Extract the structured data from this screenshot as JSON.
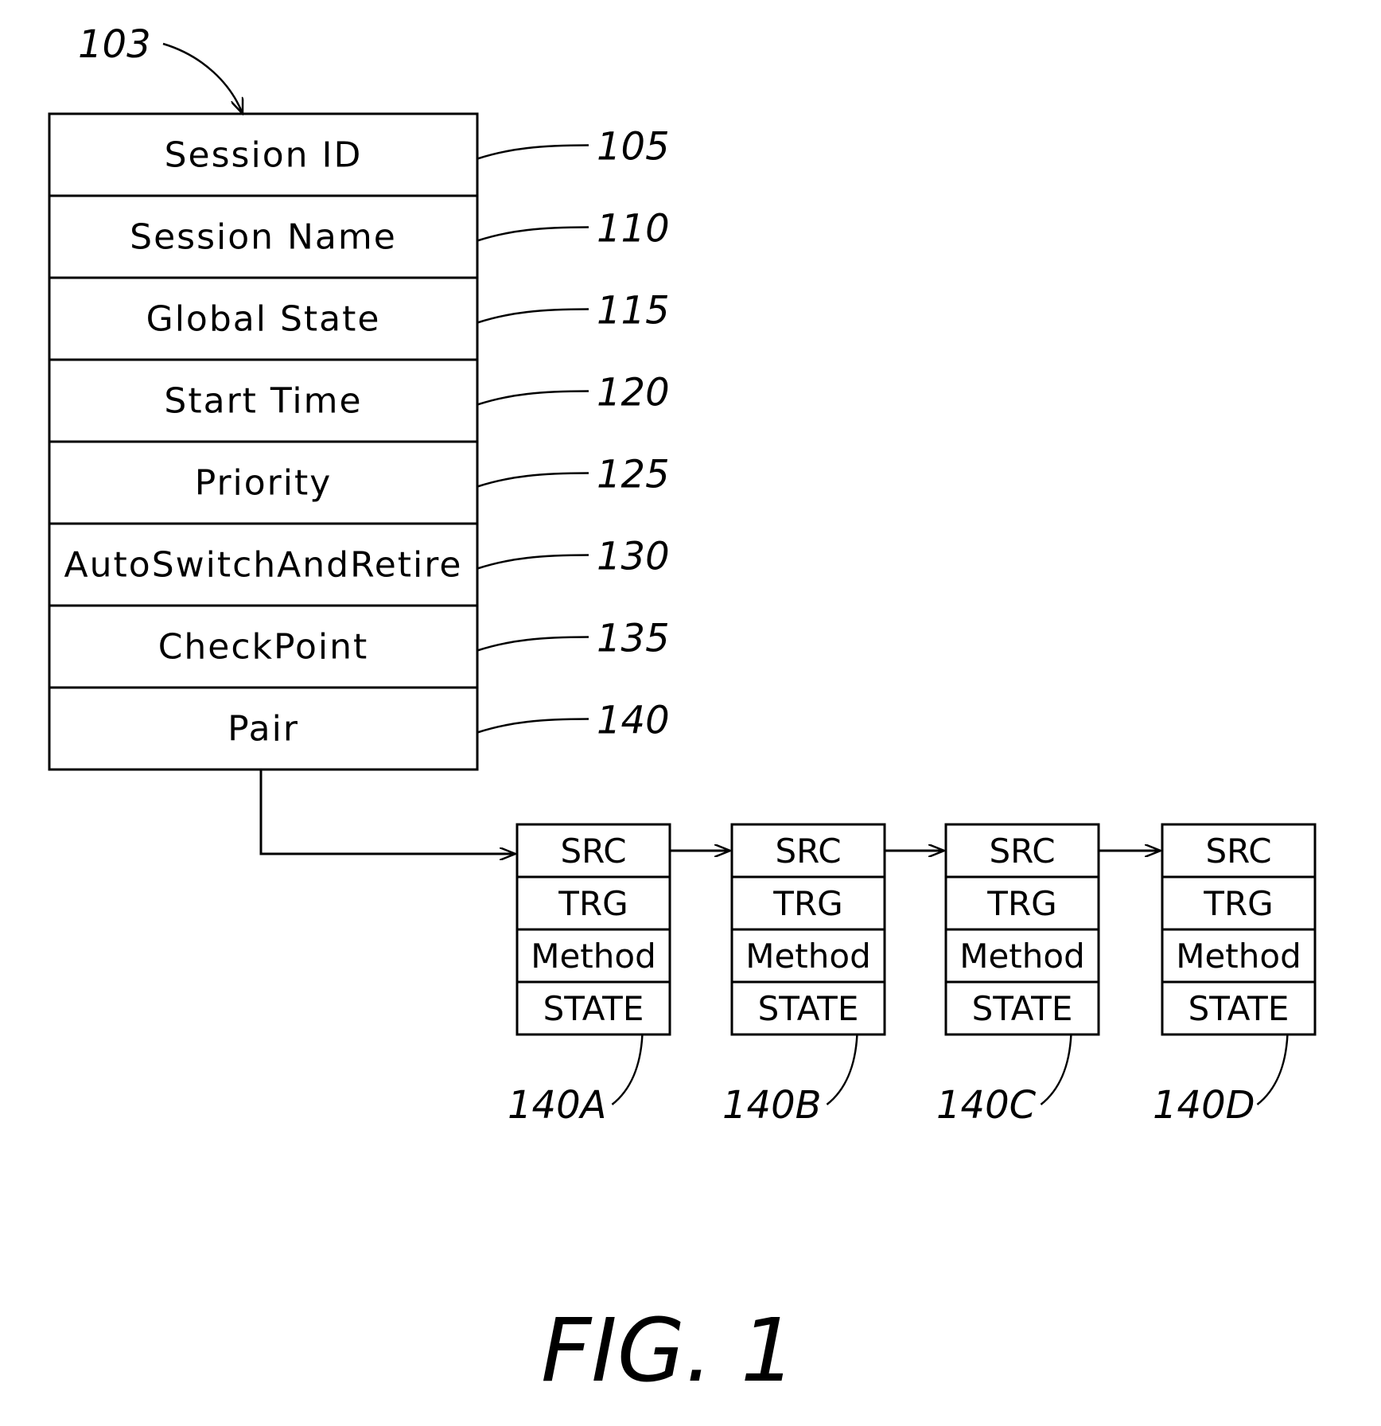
{
  "diagram": {
    "structure_ref": "103",
    "main_fields": [
      {
        "label": "Session ID",
        "ref": "105"
      },
      {
        "label": "Session Name",
        "ref": "110"
      },
      {
        "label": "Global State",
        "ref": "115"
      },
      {
        "label": "Start Time",
        "ref": "120"
      },
      {
        "label": "Priority",
        "ref": "125"
      },
      {
        "label": "AutoSwitchAndRetire",
        "ref": "130"
      },
      {
        "label": "CheckPoint",
        "ref": "135"
      },
      {
        "label": "Pair",
        "ref": "140"
      }
    ],
    "pairs": [
      {
        "ref": "140A",
        "fields": [
          "SRC",
          "TRG",
          "Method",
          "STATE"
        ]
      },
      {
        "ref": "140B",
        "fields": [
          "SRC",
          "TRG",
          "Method",
          "STATE"
        ]
      },
      {
        "ref": "140C",
        "fields": [
          "SRC",
          "TRG",
          "Method",
          "STATE"
        ]
      },
      {
        "ref": "140D",
        "fields": [
          "SRC",
          "TRG",
          "Method",
          "STATE"
        ]
      }
    ],
    "figure_label": "FIG. 1"
  }
}
